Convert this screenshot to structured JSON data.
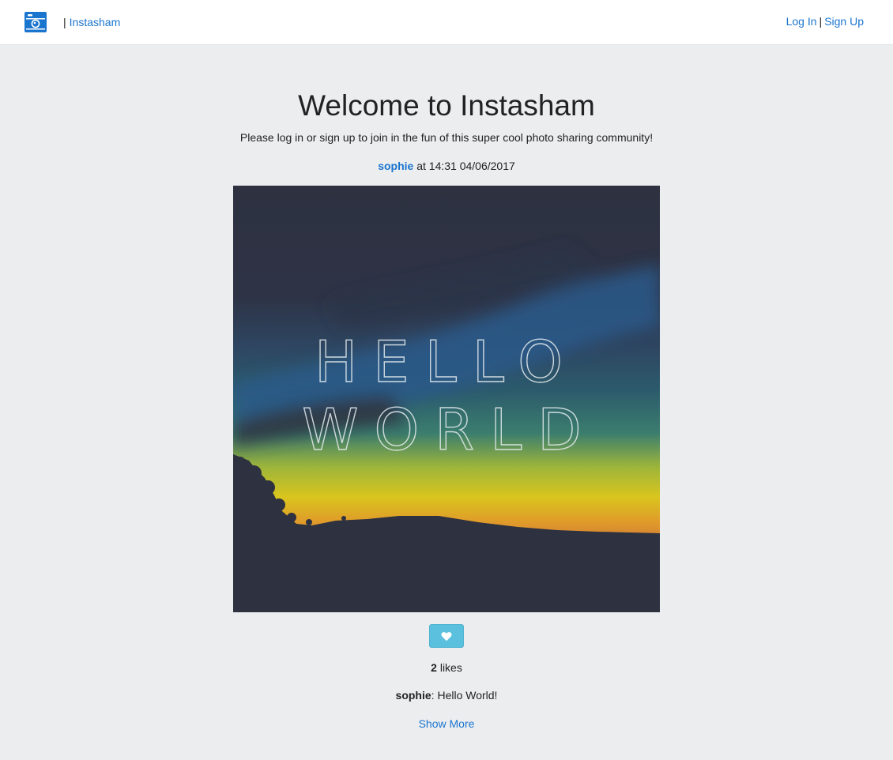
{
  "nav": {
    "separator": "|",
    "brand": "Instasham",
    "login": "Log In",
    "auth_separator": "|",
    "signup": "Sign Up",
    "logo_icon": "camera-icon"
  },
  "main": {
    "title": "Welcome to Instasham",
    "intro": "Please log in or sign up to join in the fun of this super cool photo sharing community!"
  },
  "post": {
    "author": "sophie",
    "time_text": "at 14:31 04/06/2017",
    "image_text": [
      "HELLO",
      "WORLD"
    ],
    "like_icon": "heart-icon",
    "like_count": "2",
    "likes_label": "likes",
    "comment": {
      "author": "sophie",
      "separator": ":",
      "text": "Hello World!"
    },
    "show_more": "Show More"
  },
  "colors": {
    "link": "#1a75cf",
    "background": "#ecedef",
    "like_button": "#5bc0de"
  }
}
